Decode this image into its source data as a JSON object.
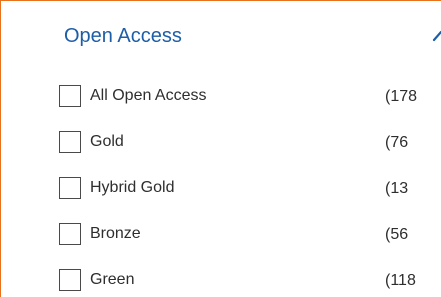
{
  "filter": {
    "title": "Open Access",
    "collapse_icon": "chevron-up-icon",
    "accent_color": "#e9711c",
    "title_color": "#1d5ea8",
    "options": [
      {
        "label": "All Open Access",
        "count": "(178",
        "checked": false
      },
      {
        "label": "Gold",
        "count": "(76",
        "checked": false
      },
      {
        "label": "Hybrid Gold",
        "count": "(13",
        "checked": false
      },
      {
        "label": "Bronze",
        "count": "(56",
        "checked": false
      },
      {
        "label": "Green",
        "count": "(118",
        "checked": false
      }
    ]
  }
}
